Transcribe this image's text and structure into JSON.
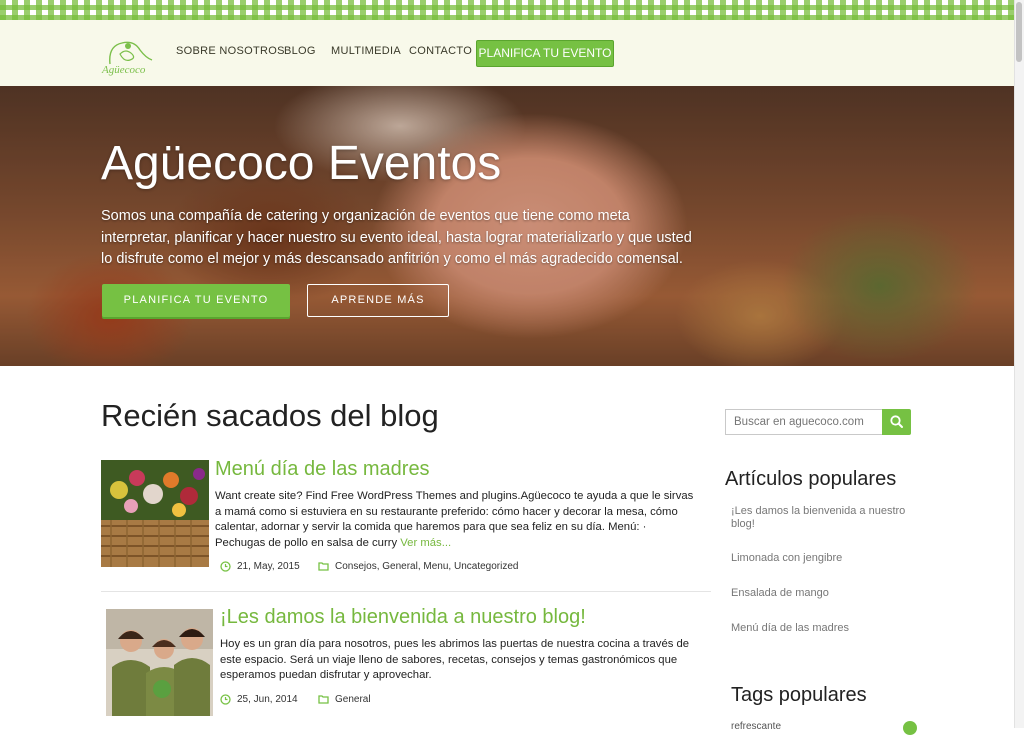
{
  "nav": {
    "logo_text": "Agüecoco",
    "links": [
      "SOBRE NOSOTROS",
      "BLOG",
      "MULTIMEDIA",
      "CONTACTO"
    ],
    "cta": "PLANIFICA TU EVENTO"
  },
  "hero": {
    "title": "Agüecoco Eventos",
    "description": "Somos una compañía de catering y organización de eventos que tiene como meta interpretar, planificar y hacer nuestro su evento ideal, hasta lograr materializarlo y que usted lo disfrute como el mejor y más descansado anfitrión y como el más agradecido comensal.",
    "primary_button": "PLANIFICA TU EVENTO",
    "secondary_button": "APRENDE MÁS"
  },
  "blog": {
    "section_title": "Recién sacados del blog",
    "posts": [
      {
        "title": "Menú día de las madres",
        "excerpt": "Want create site? Find Free WordPress Themes and plugins.Agüecoco te ayuda a que le sirvas a mamá como si estuviera en su restaurante preferido: cómo hacer y decorar la mesa, cómo calentar, adornar y servir la comida que haremos para que sea feliz en su día. Menú: · Pechugas de pollo en salsa de curry ",
        "read_more": "Ver más...",
        "date": "21, May, 2015",
        "categories": [
          "Consejos",
          "General",
          "Menu",
          "Uncategorized"
        ]
      },
      {
        "title": "¡Les damos la bienvenida a nuestro blog!",
        "excerpt": "Hoy es un gran día para nosotros, pues les abrimos las puertas de nuestra cocina a través de este espacio. Será un viaje lleno de sabores, recetas, consejos y temas gastronómicos que esperamos puedan disfrutar y aprovechar.",
        "date": "25, Jun, 2014",
        "categories": [
          "General"
        ]
      }
    ]
  },
  "sidebar": {
    "search_placeholder": "Buscar en aguecoco.com",
    "popular_title": "Artículos populares",
    "popular": [
      "¡Les damos la bienvenida a nuestro blog!",
      "Limonada con jengibre",
      "Ensalada de mango",
      "Menú día de las madres"
    ],
    "tags_title": "Tags populares",
    "first_tag": "refrescante"
  },
  "colors": {
    "accent": "#76c143",
    "link": "#76b83e",
    "nav_bg": "#f8f9ea"
  }
}
